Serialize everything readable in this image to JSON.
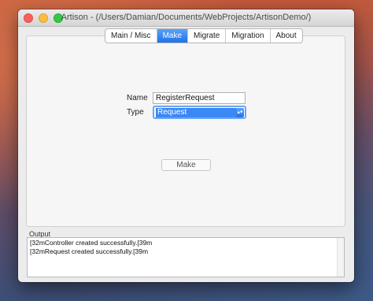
{
  "window": {
    "title": "Artison - (/Users/Damian/Documents/WebProjects/ArtisonDemo/)"
  },
  "tabs": [
    {
      "label": "Main / Misc",
      "active": false
    },
    {
      "label": "Make",
      "active": true
    },
    {
      "label": "Migrate",
      "active": false
    },
    {
      "label": "Migration",
      "active": false
    },
    {
      "label": "About",
      "active": false
    }
  ],
  "form": {
    "name_label": "Name",
    "name_value": "RegisterRequest",
    "type_label": "Type",
    "type_value": "Request",
    "make_label": "Make"
  },
  "output": {
    "label": "Output",
    "lines": [
      "[32mController created successfully.[39m",
      "[32mRequest created successfully.[39m"
    ]
  },
  "colors": {
    "accent": "#1f72ea",
    "selection": "#3b88f5"
  }
}
